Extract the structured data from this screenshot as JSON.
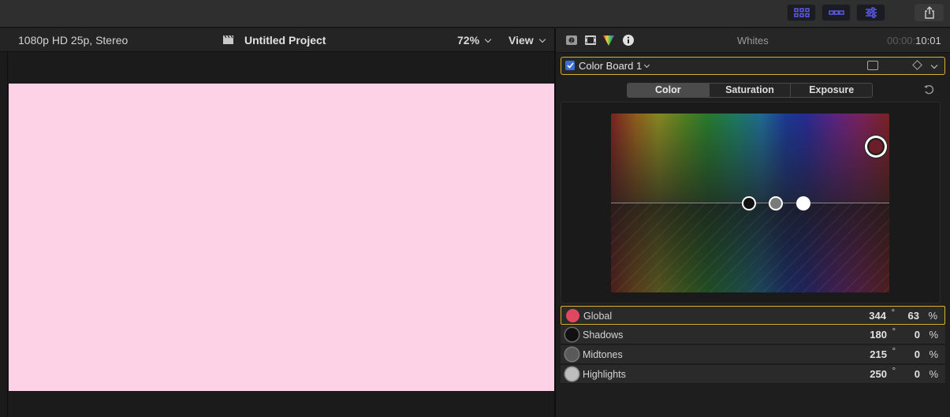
{
  "toolbar": {
    "buttons": [
      {
        "icon": "browser-grid-icon"
      },
      {
        "icon": "timeline-icon"
      },
      {
        "icon": "inspector-sliders-icon"
      }
    ],
    "share_icon": "share-icon",
    "accent": "#5a5ae6"
  },
  "viewer": {
    "format": "1080p HD 25p, Stereo",
    "project_title": "Untitled Project",
    "zoom": "72%",
    "view_menu": "View",
    "canvas_color": "#fed2e6"
  },
  "inspector": {
    "section_title": "Whites",
    "timecode_dim": "00:00:",
    "timecode_bright": "10:01",
    "effect": {
      "name": "Color Board 1",
      "enabled": true
    },
    "tabs": [
      {
        "label": "Color",
        "active": true
      },
      {
        "label": "Saturation",
        "active": false
      },
      {
        "label": "Exposure",
        "active": false
      }
    ],
    "rows": [
      {
        "label": "Global",
        "angle": "344",
        "deg": "°",
        "percent": "63",
        "pct_sign": "%",
        "swatch": "#e0485f",
        "selected": true
      },
      {
        "label": "Shadows",
        "angle": "180",
        "deg": "°",
        "percent": "0",
        "pct_sign": "%",
        "swatch": "#111111",
        "selected": false
      },
      {
        "label": "Midtones",
        "angle": "215",
        "deg": "°",
        "percent": "0",
        "pct_sign": "%",
        "swatch": "#5a5a5a",
        "selected": false
      },
      {
        "label": "Highlights",
        "angle": "250",
        "deg": "°",
        "percent": "0",
        "pct_sign": "%",
        "swatch": "#bdbdbd",
        "selected": false
      }
    ],
    "highlight_color": "#d8b02e"
  }
}
